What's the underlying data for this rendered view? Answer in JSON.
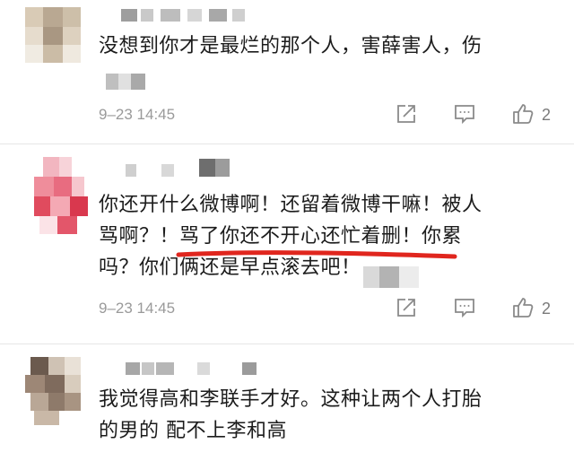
{
  "comments": [
    {
      "text_lines": [
        "没想到你才是最烂的那个人，害薛害人，伤"
      ],
      "timestamp": "9–23 14:45",
      "like_count": "2"
    },
    {
      "text_lines": [
        "你还开什么微博啊！还留着微博干嘛！被人",
        "骂啊？！骂了你还不开心还忙着删！你累",
        "吗？你们俩还是早点滚去吧！"
      ],
      "timestamp": "9–23 14:45",
      "like_count": "2"
    },
    {
      "text_lines": [
        "我觉得高和李联手才好。这种让两个人打胎",
        "的男的 配不上李和高"
      ]
    }
  ],
  "colors": {
    "underline": "#e0261e",
    "meta_text": "#9a9a9a",
    "icon": "#8a8a8a"
  }
}
